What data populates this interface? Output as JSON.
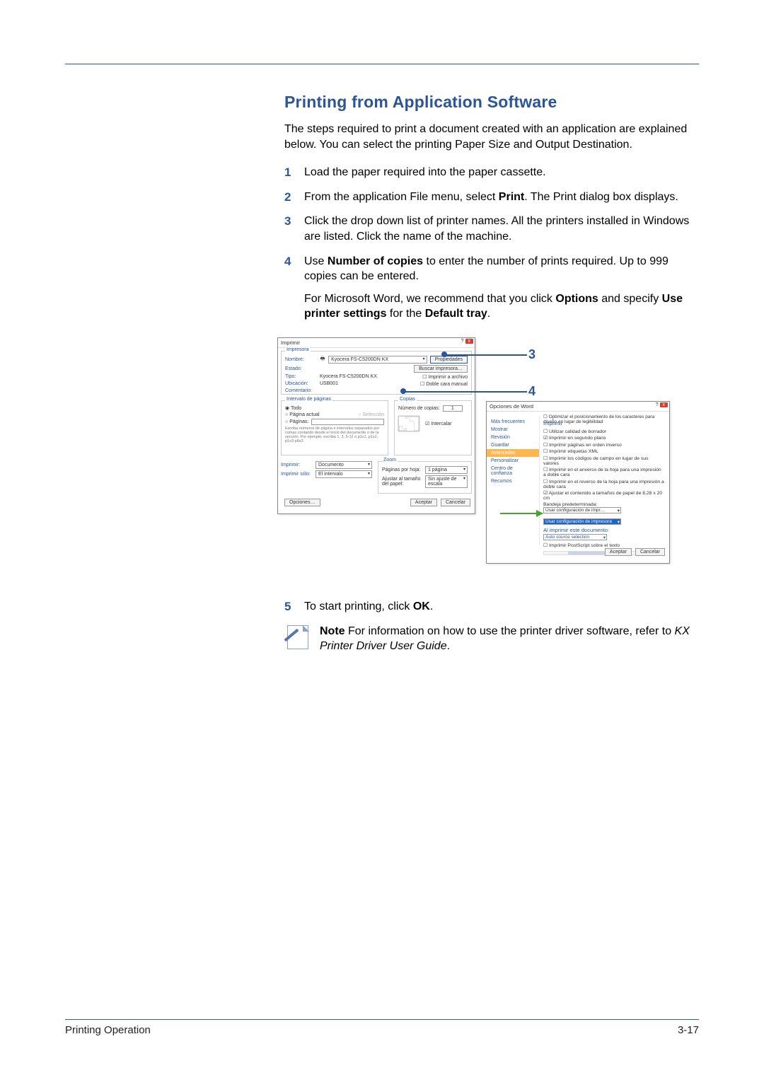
{
  "heading": "Printing from Application Software",
  "intro": "The steps required to print a document created with an application are explained below. You can select the printing Paper Size and Output Destination.",
  "steps": {
    "s1": {
      "num": "1",
      "text": "Load the paper required into the paper cassette."
    },
    "s2": {
      "num": "2",
      "pre": "From the application File menu, select ",
      "bold": "Print",
      "post": ". The Print dialog box displays."
    },
    "s3": {
      "num": "3",
      "text": "Click the drop down list of printer names. All the printers installed in Windows are listed. Click the name of the machine."
    },
    "s4": {
      "num": "4",
      "pre": "Use ",
      "bold": "Number of copies",
      "post": " to enter the number of prints required. Up to 999 copies can be entered.",
      "sub_pre": "For Microsoft Word, we recommend that you click ",
      "sub_b1": "Options",
      "sub_mid": " and specify ",
      "sub_b2": "Use printer settings",
      "sub_mid2": " for the ",
      "sub_b3": "Default tray",
      "sub_end": "."
    },
    "s5": {
      "num": "5",
      "pre": "To start printing, click ",
      "bold": "OK",
      "post": "."
    }
  },
  "callouts": {
    "c3": "3",
    "c4": "4"
  },
  "dlg1": {
    "title": "Imprimir",
    "grp_printer": "Impresora",
    "lbl_name": "Nombre:",
    "printer_name": "Kyocera FS-C5200DN KX",
    "btn_props": "Propiedades",
    "lbl_status": "Estado:",
    "lbl_type": "Tipo:",
    "type_val": "Kyocera FS-C5200DN KX",
    "lbl_loc": "Ubicación:",
    "loc_val": "USB001",
    "lbl_comment": "Comentario:",
    "btn_find": "Buscar impresora…",
    "chk_file": "Imprimir a archivo",
    "chk_duplex": "Doble cara manual",
    "grp_range": "Intervalo de páginas",
    "r_all": "Todo",
    "r_current": "Página actual",
    "r_sel": "Selección",
    "r_pages": "Páginas:",
    "range_hint": "Escriba números de página e intervalos separados por comas contando desde el inicio del documento o de la sección. Por ejemplo, escriba 1, 3, 5-12 o p1s1, p1s2, p1s3-p8s3",
    "grp_copies": "Copias",
    "lbl_numcopies": "Número de copias:",
    "copies_val": "1",
    "chk_collate": "Intercalar",
    "grp_zoom": "Zoom",
    "lbl_print": "Imprimir:",
    "print_val": "Documento",
    "lbl_printonly": "Imprimir sólo:",
    "printonly_val": "El intervalo",
    "lbl_ppp": "Páginas por hoja:",
    "ppp_val": "1 página",
    "lbl_fit": "Ajustar al tamaño del papel:",
    "fit_val": "Sin ajuste de escala",
    "btn_options": "Opciones…",
    "btn_ok": "Aceptar",
    "btn_cancel": "Cancelar"
  },
  "dlg2": {
    "title": "Opciones de Word",
    "side": {
      "i1": "Más frecuentes",
      "i2": "Mostrar",
      "i3": "Revisión",
      "i4": "Guardar",
      "i5": "Avanzadas",
      "i6": "Personalizar",
      "i7": "Centro de confianza",
      "i8": "Recursos"
    },
    "top_chk": "Optimizar el posicionamiento de los caracteres para diseño en lugar de legibilidad",
    "legend": "Imprimir",
    "l1": "Utilizar calidad de borrador",
    "l2": "Imprimir en segundo plano",
    "l3": "Imprimir páginas en orden inverso",
    "l4": "Imprimir etiquetas XML",
    "l5": "Imprimir los códigos de campo en lugar de sus valores",
    "l6": "Imprimir en el anverso de la hoja para una impresión a doble cara",
    "l7": "Imprimir en el reverso de la hoja para una impresión a doble cara",
    "l8": "Ajustar el contenido a tamaños de papel de 8,28 x 20 cm",
    "lbl_tray": "Bandeja predeterminada:",
    "tray_val": "Usar configuración de impr…",
    "tray_opt": "Usar configuración de impresora",
    "legend2": "Al imprimir este documento:",
    "doc_val": "Auto source selection",
    "p1": "Imprimir PostScript sobre el texto",
    "btn_ok": "Aceptar",
    "btn_cancel": "Cancelar"
  },
  "note": {
    "bold": "Note",
    "text": "  For information on how to use the printer driver software, refer to ",
    "ital": "KX Printer Driver User Guide",
    "end": "."
  },
  "footer": {
    "left": "Printing Operation",
    "right": "3-17"
  }
}
